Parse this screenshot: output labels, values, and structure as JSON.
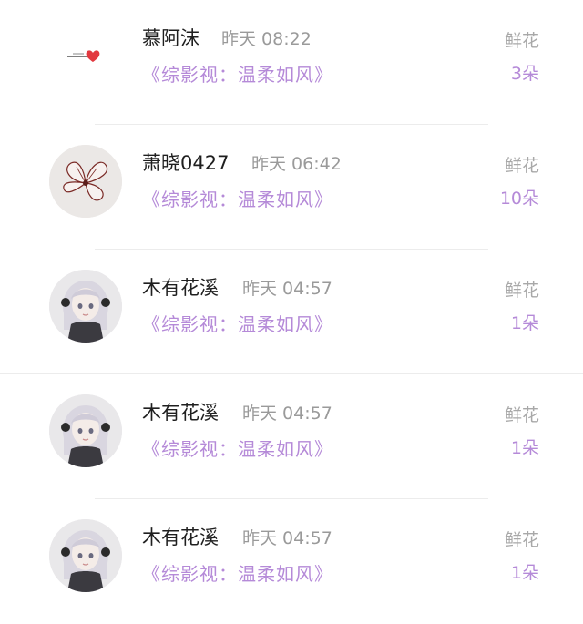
{
  "gifts": [
    {
      "user": "慕阿沫",
      "time": "昨天 08:22",
      "book": "《综影视：温柔如风》",
      "gift_type": "鲜花",
      "amount": "3朵",
      "avatar_icon": "heart-arrow-icon"
    },
    {
      "user": "萧晓0427",
      "time": "昨天 06:42",
      "book": "《综影视：温柔如风》",
      "gift_type": "鲜花",
      "amount": "10朵",
      "avatar_icon": "flower-icon"
    },
    {
      "user": "木有花溪",
      "time": "昨天 04:57",
      "book": "《综影视：温柔如风》",
      "gift_type": "鲜花",
      "amount": "1朵",
      "avatar_icon": "anime-girl-icon"
    },
    {
      "user": "木有花溪",
      "time": "昨天 04:57",
      "book": "《综影视：温柔如风》",
      "gift_type": "鲜花",
      "amount": "1朵",
      "avatar_icon": "anime-girl-icon"
    },
    {
      "user": "木有花溪",
      "time": "昨天 04:57",
      "book": "《综影视：温柔如风》",
      "gift_type": "鲜花",
      "amount": "1朵",
      "avatar_icon": "anime-girl-icon"
    }
  ],
  "colors": {
    "accent": "#b58ad8",
    "name": "#1f1f1f",
    "muted": "#9a9a9a"
  }
}
